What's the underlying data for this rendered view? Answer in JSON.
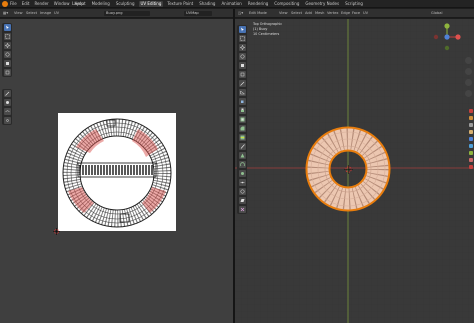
{
  "app": {
    "menus": [
      "File",
      "Edit",
      "Render",
      "Window",
      "Help"
    ],
    "workspace_tabs": [
      "Layout",
      "Modeling",
      "Sculpting",
      "UV Editing",
      "Texture Paint",
      "Shading",
      "Animation",
      "Rendering",
      "Compositing",
      "Geometry Nodes",
      "Scripting"
    ],
    "active_tab": "UV Editing"
  },
  "uv_editor": {
    "header": {
      "mode": "UV Editor",
      "menus": [
        "View",
        "Select",
        "Image",
        "UV"
      ],
      "image_name": "Buoy.png",
      "uvmap": "UVMap"
    },
    "tools": [
      "cursor",
      "select-box",
      "move",
      "rotate",
      "scale",
      "transform",
      "annotate",
      "grab",
      "relax",
      "pinch"
    ]
  },
  "viewport": {
    "header": {
      "mode": "Edit Mode",
      "menus": [
        "View",
        "Select",
        "Add",
        "Mesh",
        "Vertex",
        "Edge",
        "Face",
        "UV"
      ],
      "orientation": "Global"
    },
    "info": {
      "line1": "Top Orthographic",
      "line2": "(1) Buoy",
      "line3": "10 Centimeters"
    },
    "tools": [
      "cursor",
      "select-box",
      "move",
      "rotate",
      "scale",
      "transform",
      "annotate",
      "measure",
      "add-cube",
      "extrude",
      "inset",
      "bevel",
      "loop-cut",
      "knife",
      "poly-build",
      "spin",
      "smooth",
      "edge-slide",
      "shrink-fatten",
      "shear",
      "rip-region"
    ]
  },
  "colors": {
    "accent": "#4772b3",
    "selection": "#e87d0d",
    "axis_x": "#c4403d",
    "axis_y": "#8fb53e",
    "torus": "#ecc7b1"
  }
}
